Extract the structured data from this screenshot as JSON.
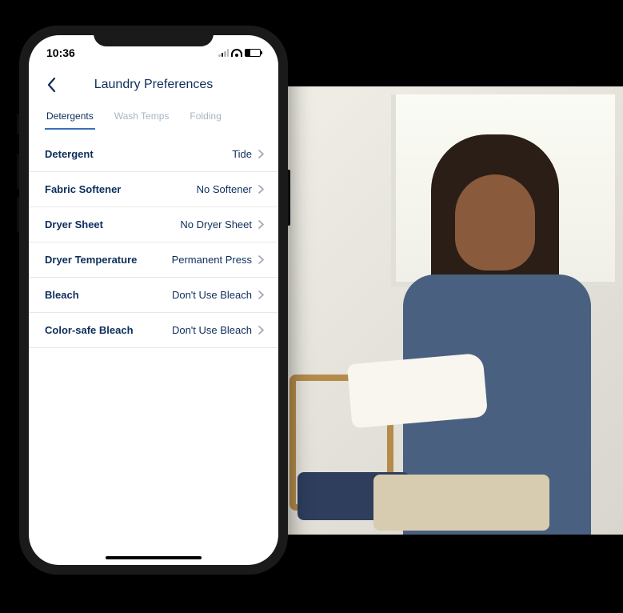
{
  "status_bar": {
    "time": "10:36",
    "battery_pct": "32"
  },
  "header": {
    "title": "Laundry Preferences"
  },
  "tabs": [
    {
      "label": "Detergents",
      "active": true
    },
    {
      "label": "Wash Temps",
      "active": false
    },
    {
      "label": "Folding",
      "active": false
    }
  ],
  "settings": [
    {
      "label": "Detergent",
      "value": "Tide"
    },
    {
      "label": "Fabric Softener",
      "value": "No Softener"
    },
    {
      "label": "Dryer Sheet",
      "value": "No Dryer Sheet"
    },
    {
      "label": "Dryer Temperature",
      "value": "Permanent Press"
    },
    {
      "label": "Bleach",
      "value": "Don't Use Bleach"
    },
    {
      "label": "Color-safe Bleach",
      "value": "Don't Use Bleach"
    }
  ]
}
